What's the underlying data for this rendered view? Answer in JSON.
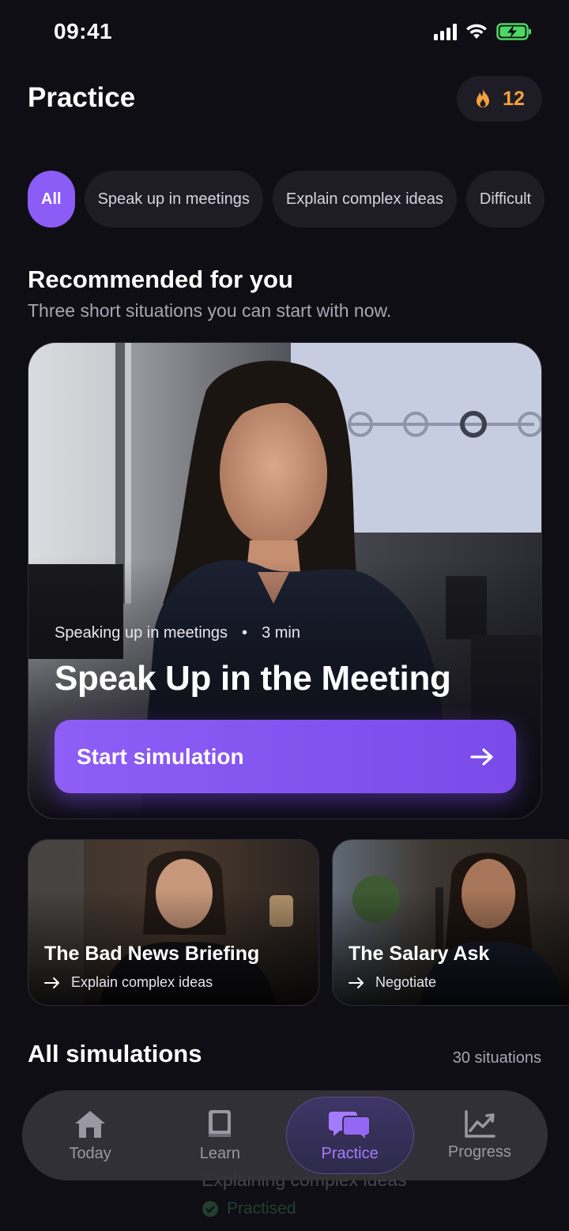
{
  "status_bar": {
    "time": "09:41"
  },
  "header": {
    "title": "Practice",
    "streak_count": "12"
  },
  "filters": [
    {
      "label": "All",
      "active": true
    },
    {
      "label": "Speak up in meetings",
      "active": false
    },
    {
      "label": "Explain complex ideas",
      "active": false
    },
    {
      "label": "Difficult",
      "active": false
    }
  ],
  "recommended": {
    "title": "Recommended for you",
    "subtitle": "Three short situations you can start with now.",
    "hero": {
      "category": "Speaking up in meetings",
      "separator": "•",
      "duration": "3 min",
      "title": "Speak Up in the Meeting",
      "button_label": "Start simulation"
    },
    "cards": [
      {
        "title": "The Bad News Briefing",
        "category": "Explain complex ideas"
      },
      {
        "title": "The Salary Ask",
        "category": "Negotiate"
      }
    ]
  },
  "all_simulations": {
    "title": "All simulations",
    "count_label": "30 situations",
    "peek_item": {
      "title": "Explaining complex ideas",
      "status": "Practised"
    }
  },
  "tabbar": {
    "items": [
      {
        "label": "Today",
        "icon": "home-icon"
      },
      {
        "label": "Learn",
        "icon": "book-icon"
      },
      {
        "label": "Practice",
        "icon": "chat-bubbles-icon"
      },
      {
        "label": "Progress",
        "icon": "chart-icon"
      }
    ],
    "active": "Practice"
  },
  "colors": {
    "accent": "#8C5CF6",
    "streak": "#F5A03D",
    "battery": "#4CD964",
    "background": "#0F0E14"
  }
}
